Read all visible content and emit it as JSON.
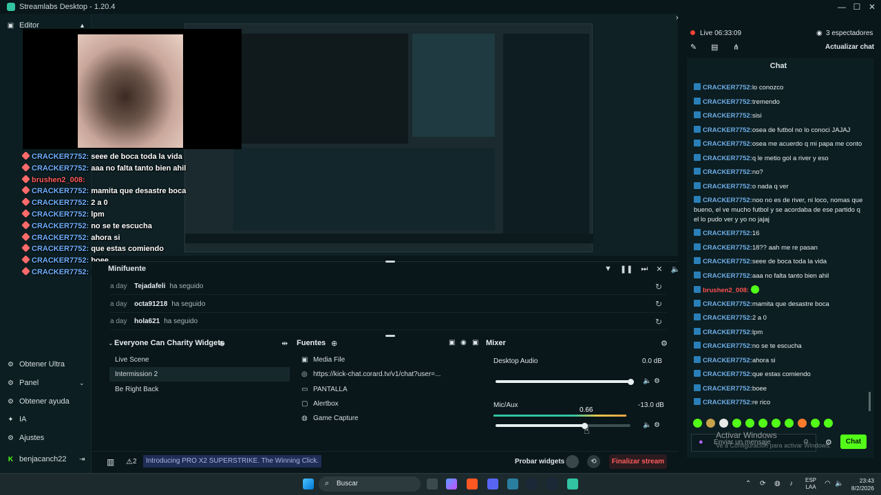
{
  "window": {
    "title": "Streamlabs Desktop - 1.20.4",
    "min": "—",
    "max": "☐",
    "close": "✕"
  },
  "sidebar": {
    "editor_label": "Editor",
    "items": [
      {
        "label": "Obtener Ultra",
        "icon": "ultra-icon"
      },
      {
        "label": "Panel",
        "icon": "panel-icon"
      },
      {
        "label": "Obtener ayuda",
        "icon": "help-icon"
      },
      {
        "label": "IA",
        "icon": "ai-icon"
      },
      {
        "label": "Ajustes",
        "icon": "gear-icon"
      }
    ],
    "user": "benjacanch22"
  },
  "overlay_chat": [
    {
      "user": "CRACKER7752:",
      "text": "seee de boca toda la vida"
    },
    {
      "user": "CRACKER7752:",
      "text": "aaa no falta tanto bien ahil"
    },
    {
      "user": "brushen2_008:",
      "text": "",
      "red": true
    },
    {
      "user": "CRACKER7752:",
      "text": "mamita que desastre boca"
    },
    {
      "user": "CRACKER7752:",
      "text": "2 a 0"
    },
    {
      "user": "CRACKER7752:",
      "text": "lpm"
    },
    {
      "user": "CRACKER7752:",
      "text": "no se te escucha"
    },
    {
      "user": "CRACKER7752:",
      "text": "ahora si"
    },
    {
      "user": "CRACKER7752:",
      "text": "que estas comiendo"
    },
    {
      "user": "CRACKER7752:",
      "text": "boee"
    },
    {
      "user": "CRACKER7752:",
      "text": "re rico"
    }
  ],
  "minifuente": {
    "title": "Minifuente",
    "events": [
      {
        "when": "a day",
        "who": "Tejadafeli",
        "what": "ha seguido"
      },
      {
        "when": "a day",
        "who": "octa91218",
        "what": "ha seguido"
      },
      {
        "when": "a day",
        "who": "hola621",
        "what": "ha seguido"
      }
    ]
  },
  "scenes": {
    "title": "Everyone Can Charity Widgets",
    "items": [
      "Live Scene",
      "Intermission 2",
      "Be Right Back"
    ],
    "selected": 1
  },
  "sources": {
    "title": "Fuentes",
    "items": [
      {
        "label": "Media File",
        "icon": "media-file-icon"
      },
      {
        "label": "https://kick-chat.corard.tv/v1/chat?user=...",
        "icon": "browser-source-icon"
      },
      {
        "label": "PANTALLA",
        "icon": "display-capture-icon"
      },
      {
        "label": "Alertbox",
        "icon": "alertbox-icon"
      },
      {
        "label": "Game Capture",
        "icon": "game-capture-icon"
      }
    ]
  },
  "mixer": {
    "title": "Mixer",
    "channels": [
      {
        "name": "Desktop Audio",
        "db": "0.0 dB",
        "level": 1.0
      },
      {
        "name": "Mic/Aux",
        "db": "-13.0 dB",
        "level": 0.66,
        "tooltip": "0.66"
      }
    ]
  },
  "footer": {
    "promo": "Introducing PRO X2 SUPERSTRIKE. The Winning Click.",
    "alert_count": "2",
    "test_widgets": "Probar widgets",
    "end_stream": "Finalizar stream"
  },
  "live": {
    "status": "Live 06:33:09",
    "viewers": "3 espectadores",
    "refresh_chat": "Actualizar chat",
    "chat_title": "Chat"
  },
  "chat": [
    {
      "user": "CRACKER7752:",
      "text": "lo conozco"
    },
    {
      "user": "CRACKER7752:",
      "text": "tremendo"
    },
    {
      "user": "CRACKER7752:",
      "text": "sisi"
    },
    {
      "user": "CRACKER7752:",
      "text": "osea de futbol no lo conoci JAJAJ"
    },
    {
      "user": "CRACKER7752:",
      "text": "osea me acuerdo q mi papa me conto"
    },
    {
      "user": "CRACKER7752:",
      "text": "q le metio gol a river y eso"
    },
    {
      "user": "CRACKER7752:",
      "text": "no?"
    },
    {
      "user": "CRACKER7752:",
      "text": "o nada q ver"
    },
    {
      "user": "CRACKER7752:",
      "text": "noo no es de river, ni loco, nomas que bueno, el ve mucho futbol y se acordaba de ese partido q el lo pudo ver y yo no jajaj"
    },
    {
      "user": "CRACKER7752:",
      "text": "16"
    },
    {
      "user": "CRACKER7752:",
      "text": "18?? aah me re pasan"
    },
    {
      "user": "CRACKER7752:",
      "text": "seee de boca toda la vida"
    },
    {
      "user": "CRACKER7752:",
      "text": "aaa no falta tanto bien ahil"
    },
    {
      "user": "brushen2_008:",
      "text": "",
      "red": true
    },
    {
      "user": "CRACKER7752:",
      "text": "mamita que desastre boca"
    },
    {
      "user": "CRACKER7752:",
      "text": "2 a 0"
    },
    {
      "user": "CRACKER7752:",
      "text": "lpm"
    },
    {
      "user": "CRACKER7752:",
      "text": "no se te escucha"
    },
    {
      "user": "CRACKER7752:",
      "text": "ahora si"
    },
    {
      "user": "CRACKER7752:",
      "text": "que estas comiendo"
    },
    {
      "user": "CRACKER7752:",
      "text": "boee"
    },
    {
      "user": "CRACKER7752:",
      "text": "re rico"
    }
  ],
  "chat_input": {
    "placeholder": "Enviar un mensaje",
    "send": "Chat",
    "watermark_title": "Activar Windows",
    "watermark_sub": "Ve a Configuración para activar Windows."
  },
  "taskbar": {
    "search": "Buscar",
    "lang": "ESP",
    "lang2": "LAA",
    "time": "23:43",
    "date": "8/2/2026"
  },
  "colors": {
    "accent": "#31c3a2",
    "danger": "#ff4f4f",
    "username": "#6faee8",
    "live": "#f44336"
  }
}
